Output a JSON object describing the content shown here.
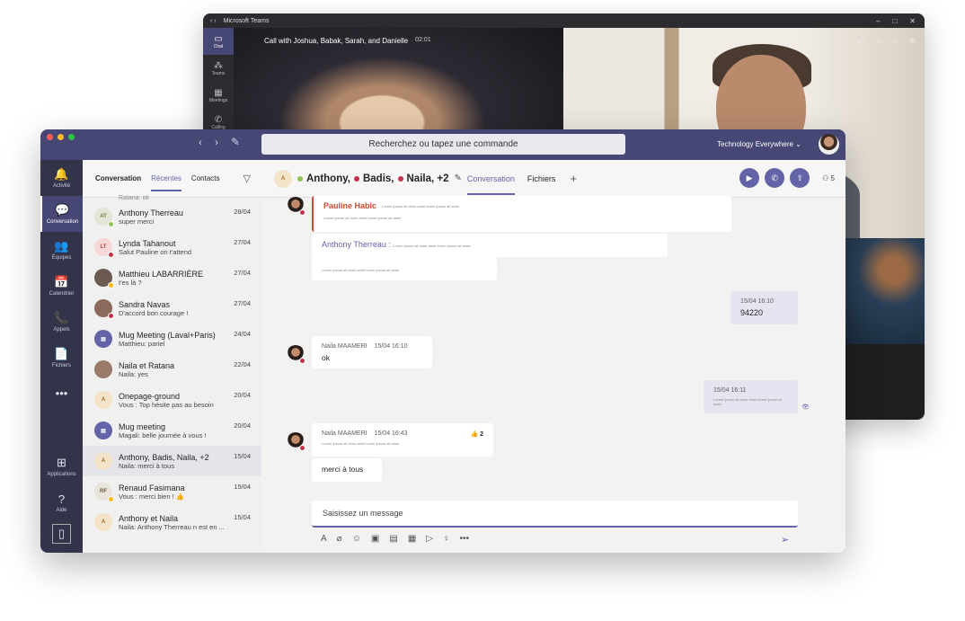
{
  "back_window": {
    "title": "Microsoft Teams",
    "call_title": "Call with Joshua, Babak, Sarah, and Danielle",
    "call_time": "02:01",
    "rail": [
      "Chat",
      "Teams",
      "Meetings",
      "Calling"
    ]
  },
  "topbar": {
    "search_placeholder": "Recherchez ou tapez une commande",
    "org": "Technology Everywhere ⌄"
  },
  "rail": {
    "items": [
      {
        "label": "Activité",
        "icon": "bell-icon",
        "glyph": "🔔"
      },
      {
        "label": "Conversation",
        "icon": "chat-icon",
        "glyph": "💬"
      },
      {
        "label": "Équipes",
        "icon": "teams-icon",
        "glyph": "👥"
      },
      {
        "label": "Calendrier",
        "icon": "calendar-icon",
        "glyph": "📅"
      },
      {
        "label": "Appels",
        "icon": "phone-icon",
        "glyph": "📞"
      },
      {
        "label": "Fichiers",
        "icon": "file-icon",
        "glyph": "📄"
      },
      {
        "label": "",
        "icon": "more-icon",
        "glyph": "•••"
      }
    ],
    "bottom": [
      {
        "label": "Applications",
        "glyph": "⊞"
      },
      {
        "label": "Aide",
        "glyph": "?"
      }
    ]
  },
  "list": {
    "tabs": [
      "Conversation",
      "Récentes",
      "Contacts"
    ],
    "top_partial": "Ratana: ok",
    "rows": [
      {
        "name": "Anthony Therreau",
        "msg": "super merci",
        "date": "28/04",
        "ini": "AT",
        "bg": "#e3e6d5",
        "fg": "#6b7a3a",
        "pr": "#92c353"
      },
      {
        "name": "Lynda Tahanout",
        "msg": "Salut Pauline on t'attend",
        "date": "27/04",
        "ini": "LT",
        "bg": "#f6d8d8",
        "fg": "#a44",
        "pr": "#c4314b"
      },
      {
        "name": "Matthieu LABARRIÈRE",
        "msg": "t'es là ?",
        "date": "27/04",
        "ini": "",
        "bg": "#6b5a50",
        "fg": "#fff",
        "pr": "#fdb913"
      },
      {
        "name": "Sandra Navas",
        "msg": "D'accord bon courage !",
        "date": "27/04",
        "ini": "",
        "bg": "#8a6a5a",
        "fg": "#fff",
        "pr": "#c4314b"
      },
      {
        "name": "Mug Meeting (Laval+Paris)",
        "msg": "Matthieu: pariel",
        "date": "24/04",
        "ini": "▤",
        "bg": "#6264a7",
        "fg": "#fff",
        "pr": ""
      },
      {
        "name": "Naila et Ratana",
        "msg": "Naila: yes",
        "date": "22/04",
        "ini": "",
        "bg": "#9a7a68",
        "fg": "#fff",
        "pr": ""
      },
      {
        "name": "Onepage-ground",
        "msg": "Vous : Top hésite pas au besoin",
        "date": "20/04",
        "ini": "A",
        "bg": "#f3e3c8",
        "fg": "#a06a20",
        "pr": ""
      },
      {
        "name": "Mug meeting",
        "msg": "Magali: belle journée à vous !",
        "date": "20/04",
        "ini": "▤",
        "bg": "#6264a7",
        "fg": "#fff",
        "pr": ""
      },
      {
        "name": "Anthony, Badis, Naila, +2",
        "msg": "Naila: merci à tous",
        "date": "15/04",
        "ini": "A",
        "bg": "#f3e3c8",
        "fg": "#a06a20",
        "pr": ""
      },
      {
        "name": "Renaud Fasimana",
        "msg": "Vous : merci bien ! 👍",
        "date": "15/04",
        "ini": "RF",
        "bg": "#e8e4dc",
        "fg": "#6b5a3a",
        "pr": "#fdb913"
      },
      {
        "name": "Anthony et Naila",
        "msg": "Naila: Anthony Therreau n est en ...",
        "date": "15/04",
        "ini": "A",
        "bg": "#f3e3c8",
        "fg": "#a06a20",
        "pr": ""
      }
    ]
  },
  "chat": {
    "header_names": [
      "Anthony,",
      "Badis,",
      "Naila, +2"
    ],
    "tab_conversation": "Conversation",
    "tab_files": "Fichiers",
    "people_count": "5",
    "quote_author": "Pauline Habic",
    "reply_author": "Anthony Therreau :",
    "m1_time": "15/04 16:10",
    "m1_text": "94220",
    "m2_author": "Naila MAAMERI",
    "m2_time": "15/04 16:10",
    "m2_text": "ok",
    "m3_time": "15/04 16:11",
    "m4_author": "Naila MAAMERI",
    "m4_time": "15/04 16:43",
    "m4_likes": "👍 2",
    "m5_text": "merci à tous",
    "compose_placeholder": "Saisissez un message",
    "lorem": "Lorem ipsum sit dolor amet lorem ipsum sit amet"
  }
}
